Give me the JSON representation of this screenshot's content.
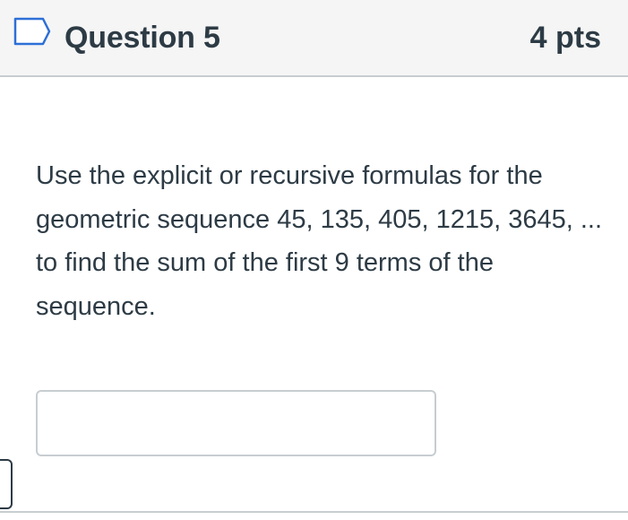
{
  "question": {
    "title": "Question 5",
    "points": "4 pts",
    "flag_icon": "bookmark-flag-icon",
    "text": "Use the explicit or recursive formulas for the geometric sequence 45, 135, 405, 1215, 3645, ... to find the sum of the first 9 terms of the sequence.",
    "answer": {
      "value": "",
      "placeholder": ""
    }
  },
  "colors": {
    "header_background": "#f5f5f5",
    "text": "#2d3b45",
    "border": "#c7cdd1"
  }
}
